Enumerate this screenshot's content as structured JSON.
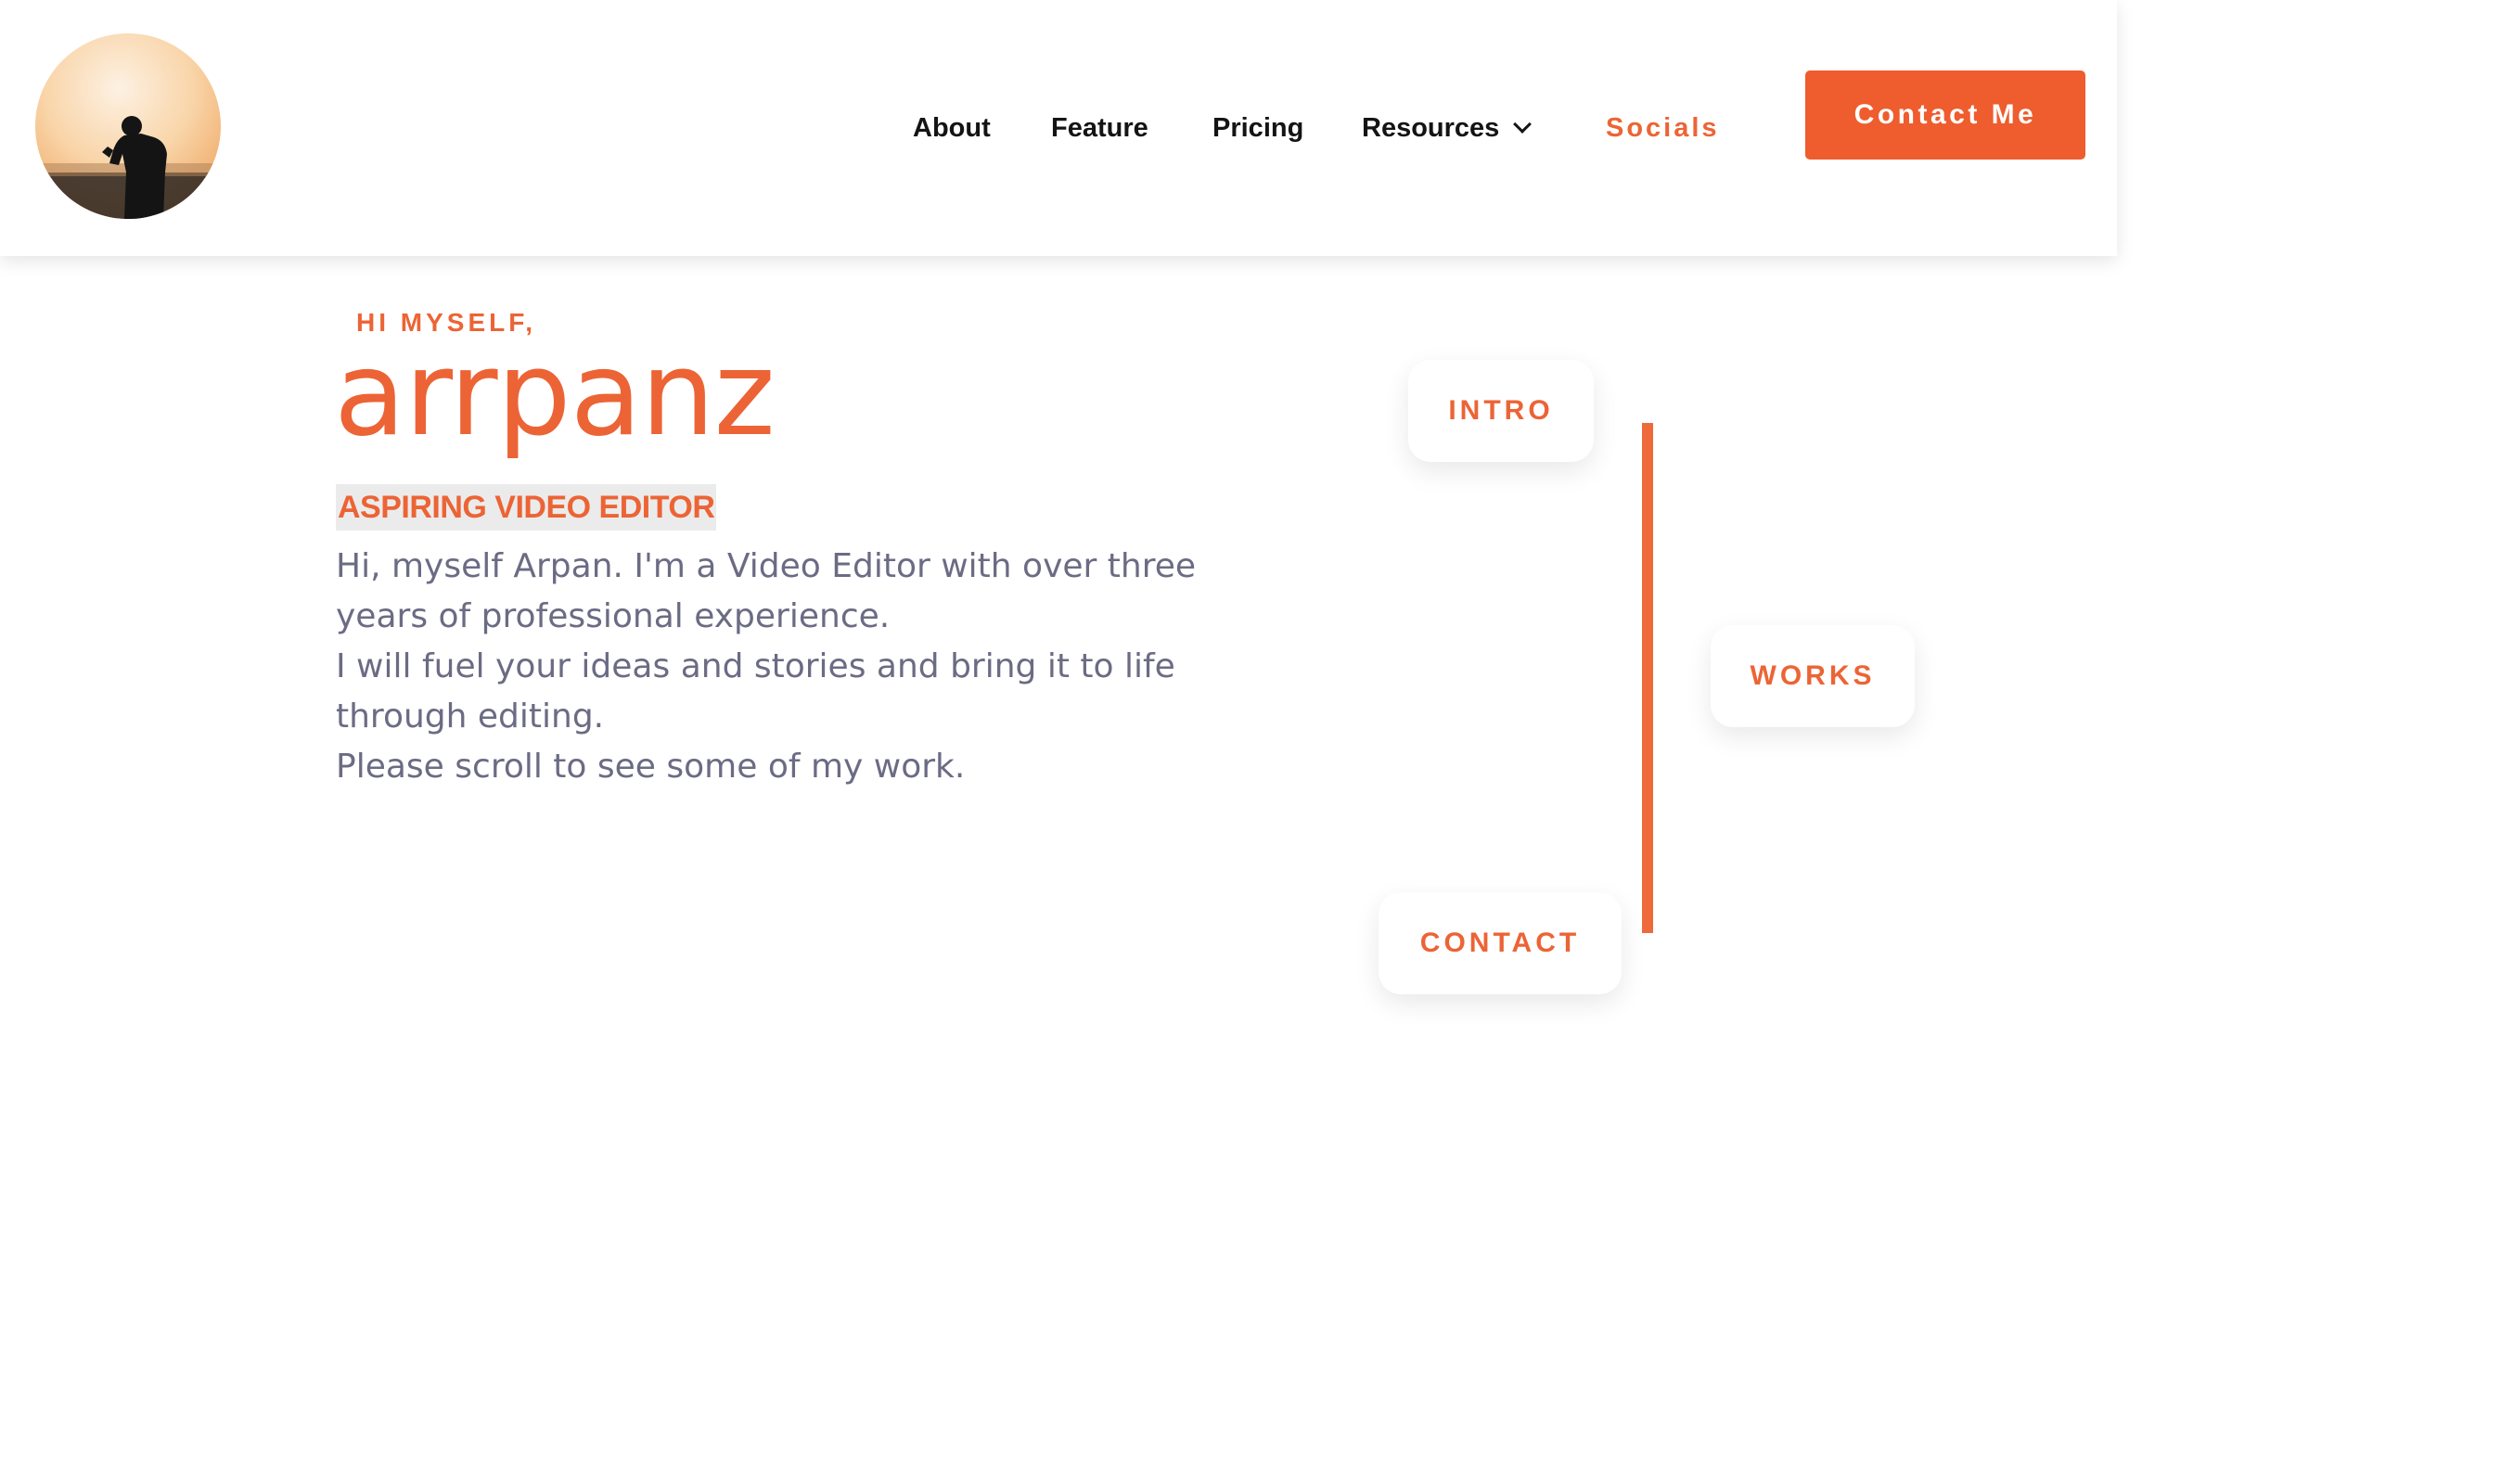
{
  "header": {
    "avatar_alt": "profile photo",
    "nav": [
      {
        "label": "About"
      },
      {
        "label": "Feature"
      },
      {
        "label": "Pricing"
      },
      {
        "label": "Resources"
      },
      {
        "label": "Socials"
      }
    ],
    "contact_button": "Contact Me"
  },
  "hero": {
    "eyebrow": "HI MYSELF,",
    "name": "arrpanz",
    "role": "ASPIRING VIDEO EDITOR",
    "bio": [
      "Hi, myself Arpan. I'm a Video Editor with over three years of professional experience.",
      "I will fuel your ideas and stories and bring it to life through editing.",
      "Please scroll to see some of my work."
    ]
  },
  "timeline": {
    "items": [
      {
        "label": "INTRO"
      },
      {
        "label": "WORKS"
      },
      {
        "label": "CONTACT"
      }
    ]
  },
  "colors": {
    "accent": "#ec6435",
    "button": "#ef5c2d",
    "body_text": "#6b6b84",
    "nav_text": "#141414"
  },
  "icons": {
    "dropdown": "chevron-down-icon"
  }
}
